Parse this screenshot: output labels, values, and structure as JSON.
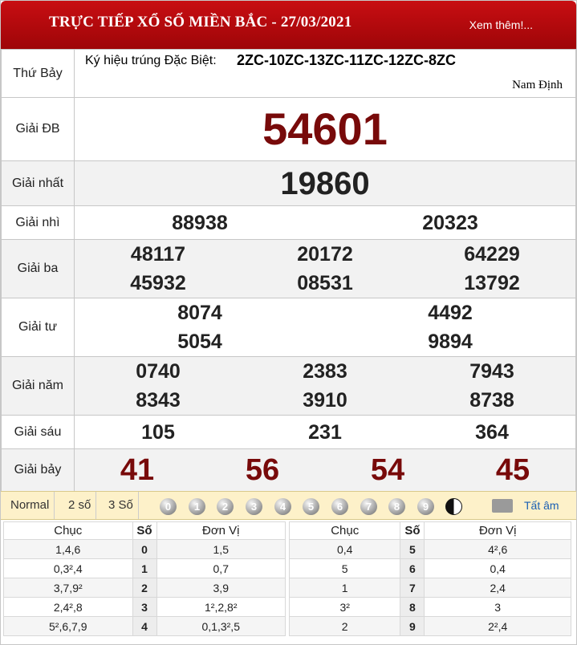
{
  "header": {
    "title": "TRỰC TIẾP XỔ SỐ MIỀN BẮC - 27/03/2021",
    "more": "Xem thêm!..."
  },
  "info": {
    "day": "Thứ Bảy",
    "special_label": "Ký hiệu trúng Đặc Biệt:",
    "special_codes": "2ZC-10ZC-13ZC-11ZC-12ZC-8ZC",
    "province": "Nam Định"
  },
  "prizes": {
    "db": {
      "label": "Giải ĐB",
      "values": [
        "54601"
      ]
    },
    "nhat": {
      "label": "Giải nhất",
      "values": [
        "19860"
      ]
    },
    "nhi": {
      "label": "Giải nhì",
      "values": [
        "88938",
        "20323"
      ]
    },
    "ba": {
      "label": "Giải ba",
      "values": [
        "48117",
        "20172",
        "64229",
        "45932",
        "08531",
        "13792"
      ]
    },
    "tu": {
      "label": "Giải tư",
      "values": [
        "8074",
        "4492",
        "5054",
        "9894"
      ]
    },
    "nam": {
      "label": "Giải năm",
      "values": [
        "0740",
        "2383",
        "7943",
        "8343",
        "3910",
        "8738"
      ]
    },
    "sau": {
      "label": "Giải sáu",
      "values": [
        "105",
        "231",
        "364"
      ]
    },
    "bay": {
      "label": "Giải bảy",
      "values": [
        "41",
        "56",
        "54",
        "45"
      ]
    }
  },
  "controls": {
    "normal": "Normal",
    "two": "2 số",
    "three": "3 Số",
    "balls": [
      "0",
      "1",
      "2",
      "3",
      "4",
      "5",
      "6",
      "7",
      "8",
      "9"
    ],
    "mute_all": "Tất âm"
  },
  "loto": {
    "headers": {
      "chuc": "Chục",
      "so": "Số",
      "donvi": "Đơn Vị"
    },
    "left": [
      {
        "chuc": "1,4,6",
        "so": "0",
        "donvi": "1,5"
      },
      {
        "chuc": "0,3²,4",
        "so": "1",
        "donvi": "0,7"
      },
      {
        "chuc": "3,7,9²",
        "so": "2",
        "donvi": "3,9"
      },
      {
        "chuc": "2,4²,8",
        "so": "3",
        "donvi": "1²,2,8²"
      },
      {
        "chuc": "5²,6,7,9",
        "so": "4",
        "donvi": "0,1,3²,5"
      }
    ],
    "right": [
      {
        "chuc": "0,4",
        "so": "5",
        "donvi": "4²,6"
      },
      {
        "chuc": "5",
        "so": "6",
        "donvi": "0,4"
      },
      {
        "chuc": "1",
        "so": "7",
        "donvi": "2,4"
      },
      {
        "chuc": "3²",
        "so": "8",
        "donvi": "3"
      },
      {
        "chuc": "2",
        "so": "9",
        "donvi": "2²,4"
      }
    ]
  }
}
